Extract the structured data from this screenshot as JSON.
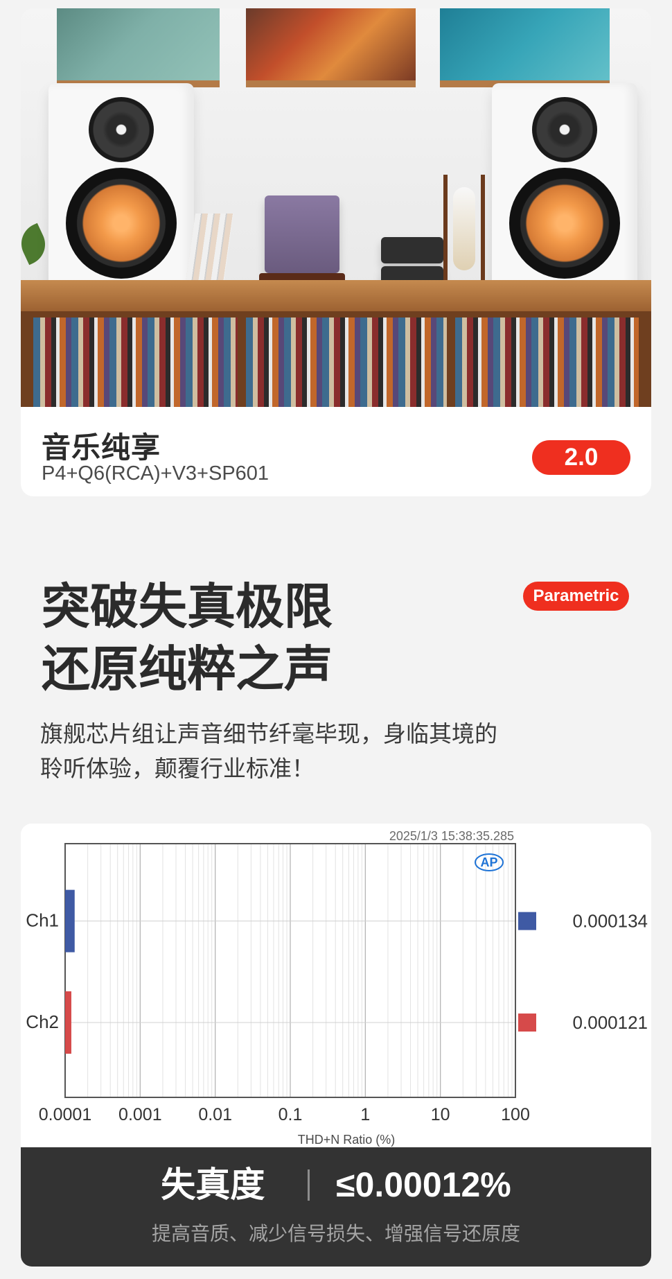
{
  "product_card": {
    "title": "音乐纯享",
    "subtitle": "P4+Q6(RCA)+V3+SP601",
    "badge": "2.0"
  },
  "section": {
    "headline_line1": "突破失真极限",
    "headline_line2": "还原纯粹之声",
    "tag": "Parametric",
    "description_line1": "旗舰芯片组让声音细节纤毫毕现，身临其境的",
    "description_line2": "聆听体验，颠覆行业标准！"
  },
  "chart_data": {
    "type": "bar",
    "timestamp": "2025/1/3 15:38:35.285",
    "logo_text": "AP",
    "categories": [
      "Ch1",
      "Ch2"
    ],
    "values": [
      0.000134,
      0.000121
    ],
    "value_labels": [
      "0.000134",
      "0.000121"
    ],
    "series_colors": [
      "#3f5aa4",
      "#d64a4a"
    ],
    "x_scale": "log",
    "x_ticks": [
      "0.0001",
      "0.001",
      "0.01",
      "0.1",
      "1",
      "10",
      "100"
    ],
    "xlim": [
      0.0001,
      100
    ],
    "xlabel": "THD+N Ratio (%)"
  },
  "summary": {
    "label": "失真度",
    "value": "≤0.00012%",
    "note": "提高音质、减少信号损失、增强信号还原度"
  }
}
